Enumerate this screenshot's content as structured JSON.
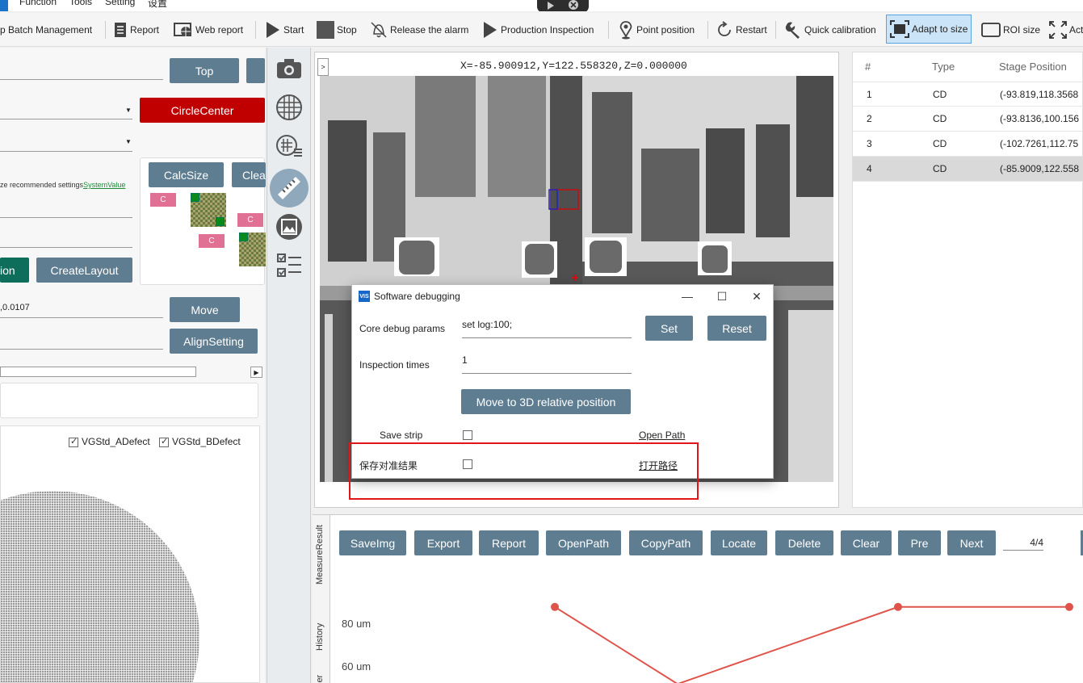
{
  "menubar": {
    "items": [
      "Function",
      "Tools",
      "Setting",
      "设置"
    ],
    "title_fragment": "..."
  },
  "toolbar": {
    "items": [
      {
        "label": "p Batch Management",
        "icon": "batch-icon"
      },
      {
        "label": "Report",
        "icon": "report-icon"
      },
      {
        "label": "Web report",
        "icon": "web-report-icon"
      },
      {
        "label": "Start",
        "icon": "play-icon"
      },
      {
        "label": "Stop",
        "icon": "stop-icon"
      },
      {
        "label": "Release the alarm",
        "icon": "bell-off-icon"
      },
      {
        "label": "Production Inspection",
        "icon": "play-icon"
      },
      {
        "label": "Point position",
        "icon": "pin-icon"
      },
      {
        "label": "Restart",
        "icon": "restart-icon"
      },
      {
        "label": "Quick calibration",
        "icon": "wrench-icon"
      },
      {
        "label": "Adapt to size",
        "icon": "fit-icon"
      },
      {
        "label": "ROI size",
        "icon": "roi-icon"
      },
      {
        "label": "Act",
        "icon": "actual-size-icon"
      }
    ]
  },
  "left": {
    "top_btn": "Top",
    "circle_center_btn": "CircleCenter",
    "calcsize_btn": "CalcSize",
    "clear_btn": "Clea",
    "recommended_text": "ze recommended settings",
    "system_value_link": "SystemValue",
    "ion_btn": "ion",
    "create_layout_btn": "CreateLayout",
    "coord_value": ",0.0107",
    "move_btn": "Move",
    "align_setting_btn": "AlignSetting",
    "layout_cells": [
      "C",
      "C",
      "C"
    ],
    "checkbox_a": "VGStd_ADefect",
    "checkbox_b": "VGStd_BDefect"
  },
  "viewer": {
    "coordinate": "X=-85.900912,Y=122.558320,Z=0.000000",
    "toggle": ">"
  },
  "table": {
    "headers": [
      "#",
      "Type",
      "Stage Position"
    ],
    "rows": [
      {
        "n": "1",
        "type": "CD",
        "pos": "(-93.819,118.3568"
      },
      {
        "n": "2",
        "type": "CD",
        "pos": "(-93.8136,100.156"
      },
      {
        "n": "3",
        "type": "CD",
        "pos": "(-102.7261,112.75"
      },
      {
        "n": "4",
        "type": "CD",
        "pos": "(-85.9009,122.558"
      }
    ]
  },
  "dialog": {
    "title": "Software debugging",
    "logo": "VIS",
    "core_label": "Core debug params",
    "core_value": "set log:100;",
    "set_btn": "Set",
    "reset_btn": "Reset",
    "times_label": "Inspection times",
    "times_value": "1",
    "move3d_btn": "Move to 3D relative position",
    "save_strip_label": "Save strip",
    "open_path_link": "Open Path",
    "save_align_label": "保存对准结果",
    "open_path_cn_link": "打开路径",
    "min_glyph": "—",
    "max_glyph": "☐",
    "close_glyph": "✕"
  },
  "bottom": {
    "vtabs": [
      "MeasureResult",
      "History",
      "ler"
    ],
    "buttons": [
      "SaveImg",
      "Export",
      "Report",
      "OpenPath",
      "CopyPath",
      "Locate",
      "Delete",
      "Clear",
      "Pre",
      "Next"
    ],
    "page": "4/4",
    "y_ticks": [
      "80 um",
      "60 um"
    ]
  },
  "chart_data": {
    "type": "line",
    "x": [
      1,
      2,
      3,
      4
    ],
    "values": [
      88,
      52,
      88,
      88
    ],
    "y_ticks": [
      "80 um",
      "60 um"
    ],
    "color": "#e0534a"
  },
  "colors": {
    "accent": "#1c72c8",
    "button": "#5f7d91",
    "danger": "#c00000",
    "highlight": "#e0161b",
    "link": "#1f8a3b"
  }
}
